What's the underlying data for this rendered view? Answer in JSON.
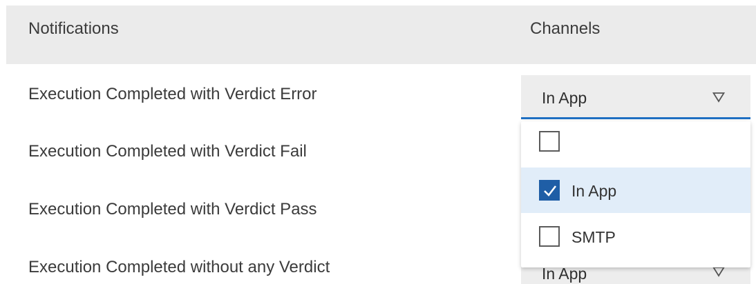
{
  "table": {
    "header": {
      "notifications": "Notifications",
      "channels": "Channels"
    },
    "rows": [
      {
        "label": "Execution Completed with Verdict Error",
        "channel": "In App"
      },
      {
        "label": "Execution Completed with Verdict Fail"
      },
      {
        "label": "Execution Completed with Verdict Pass"
      },
      {
        "label": "Execution Completed without any Verdict",
        "channel": "In App"
      }
    ]
  },
  "dropdown": {
    "options": [
      {
        "label": "",
        "checked": false
      },
      {
        "label": "In App",
        "checked": true
      },
      {
        "label": "SMTP",
        "checked": false
      }
    ]
  },
  "colors": {
    "accent": "#1f6fc2",
    "checkbox_checked": "#1f5ea6",
    "selected_option_bg": "#e1edf9",
    "header_bg": "#ebebeb"
  },
  "icons": {
    "select_caret": "triangle-down-outline-icon",
    "check": "checkmark-icon"
  }
}
